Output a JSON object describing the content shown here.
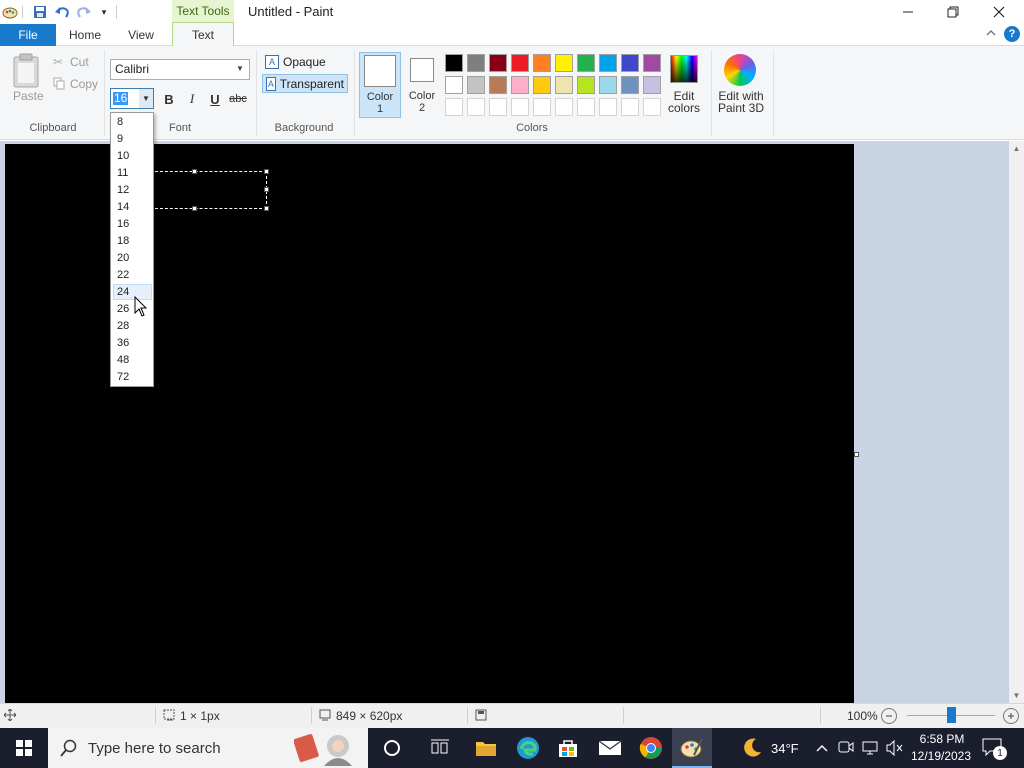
{
  "window": {
    "title": "Untitled - Paint",
    "context_tab_header": "Text Tools"
  },
  "tabs": {
    "file": "File",
    "home": "Home",
    "view": "View",
    "text": "Text"
  },
  "clipboard": {
    "paste": "Paste",
    "cut": "Cut",
    "copy": "Copy",
    "group_label": "Clipboard"
  },
  "font": {
    "name": "Calibri",
    "size": "16",
    "bold": "B",
    "italic": "I",
    "underline": "U",
    "strike": "abc",
    "group_label": "Font"
  },
  "background": {
    "opaque": "Opaque",
    "transparent": "Transparent",
    "group_label": "Background"
  },
  "colors": {
    "color1_line1": "Color",
    "color1_line2": "1",
    "color2_line1": "Color",
    "color2_line2": "2",
    "edit_line1": "Edit",
    "edit_line2": "colors",
    "paint3d_line1": "Edit with",
    "paint3d_line2": "Paint 3D",
    "group_label": "Colors",
    "palette": [
      "#000000",
      "#7f7f7f",
      "#880015",
      "#ed1c24",
      "#ff7f27",
      "#fff200",
      "#22b14c",
      "#00a2e8",
      "#3f48cc",
      "#a349a4",
      "#ffffff",
      "#c3c3c3",
      "#b97a57",
      "#ffaec9",
      "#ffc90e",
      "#efe4b0",
      "#b5e61d",
      "#99d9ea",
      "#7092be",
      "#c8bfe7",
      "#ffffff",
      "#ffffff",
      "#ffffff",
      "#ffffff",
      "#ffffff",
      "#ffffff",
      "#ffffff",
      "#ffffff",
      "#ffffff",
      "#ffffff"
    ]
  },
  "size_dropdown": {
    "options": [
      "8",
      "9",
      "10",
      "11",
      "12",
      "14",
      "16",
      "18",
      "20",
      "22",
      "24",
      "26",
      "28",
      "36",
      "48",
      "72"
    ],
    "highlighted": "24"
  },
  "status": {
    "selection": "1 × 1px",
    "canvas_size": "849 × 620px",
    "zoom": "100%",
    "zoom_slider_fraction": 0.5
  },
  "taskbar": {
    "search_placeholder": "Type here to search",
    "weather": "34°F",
    "time": "6:58 PM",
    "date": "12/19/2023",
    "notification_count": "1"
  }
}
